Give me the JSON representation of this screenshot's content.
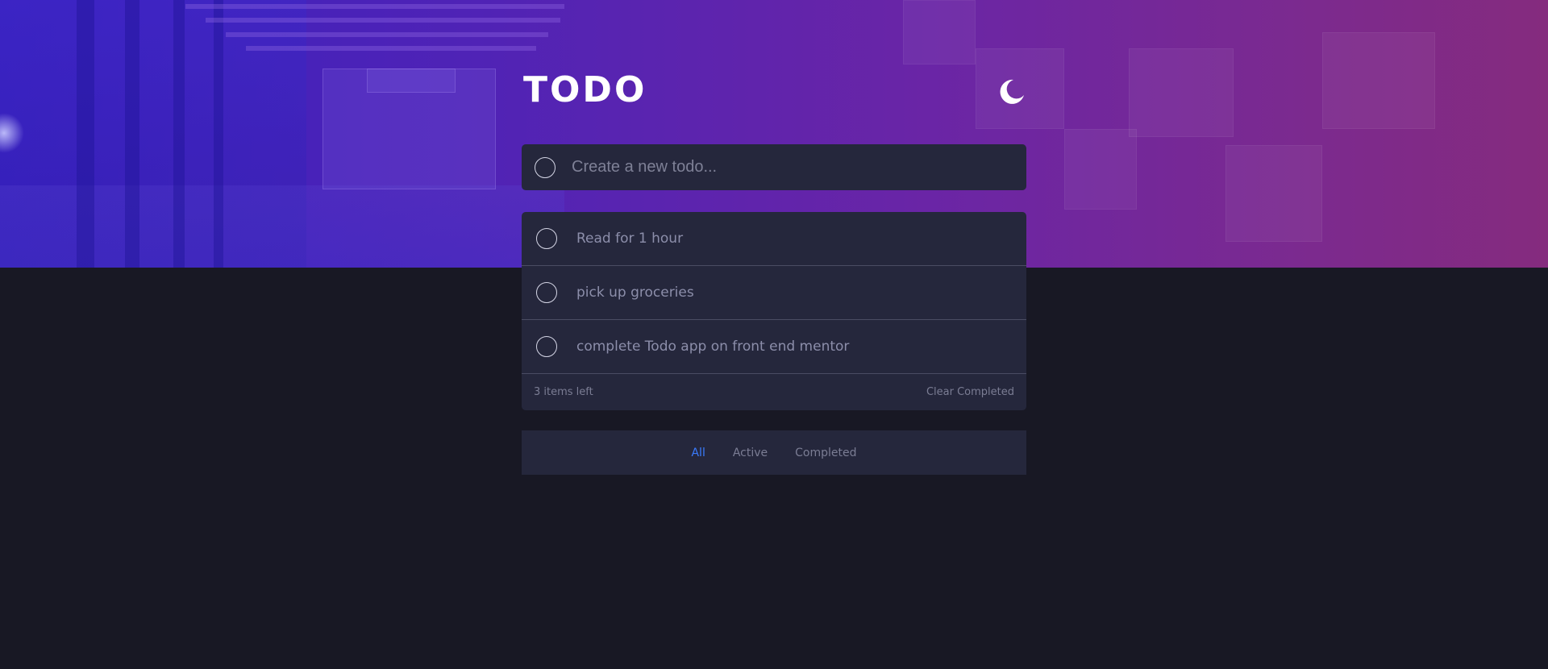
{
  "app": {
    "title": "TODO",
    "theme_icon": "moon-icon"
  },
  "new_todo": {
    "placeholder": "Create a new todo..."
  },
  "todos": [
    {
      "text": "Read for 1 hour",
      "completed": false
    },
    {
      "text": "pick up groceries",
      "completed": false
    },
    {
      "text": "complete Todo app on front end mentor",
      "completed": false
    }
  ],
  "footer": {
    "items_left": "3 items left",
    "clear_label": "Clear Completed"
  },
  "filters": [
    {
      "label": "All",
      "active": true
    },
    {
      "label": "Active",
      "active": false
    },
    {
      "label": "Completed",
      "active": false
    }
  ],
  "colors": {
    "accent": "#3a7bfd",
    "card": "#25273c",
    "background": "#181824"
  }
}
